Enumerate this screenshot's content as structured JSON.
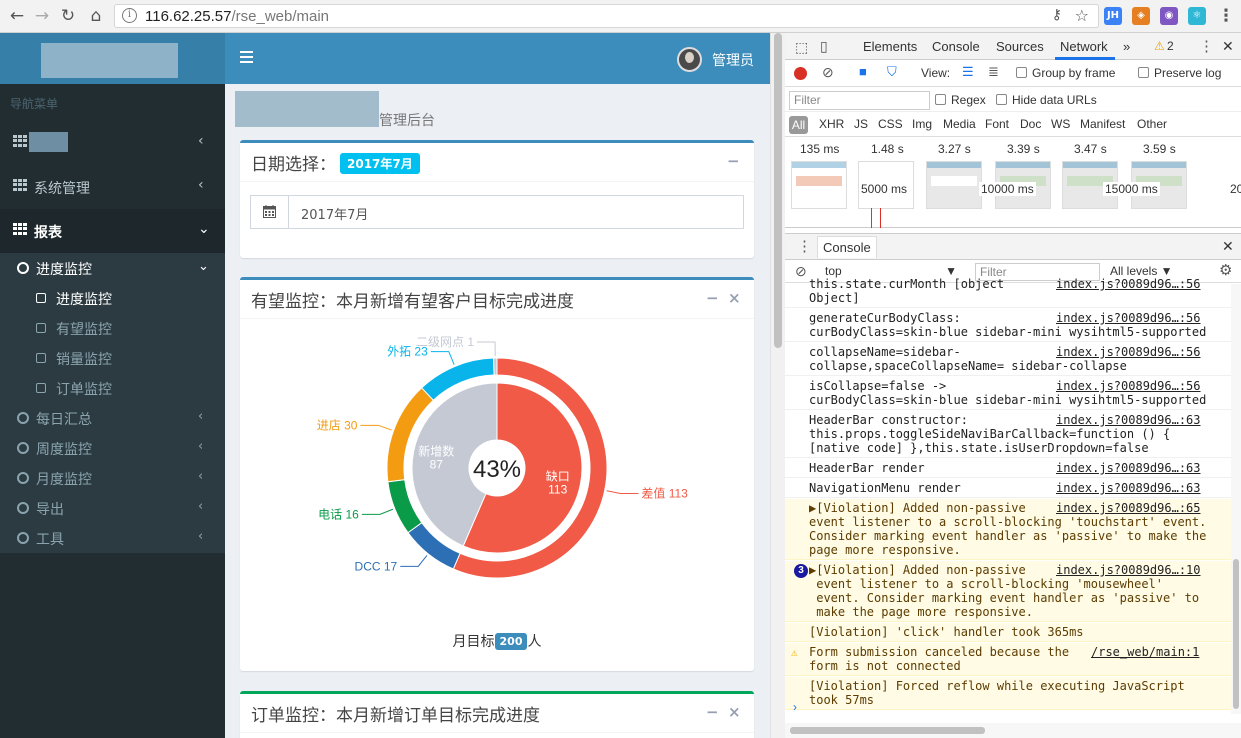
{
  "browser": {
    "url_host": "116.62.25.57",
    "url_path": "/rse_web/main",
    "extensions": [
      {
        "name": "jh-extension-icon",
        "label": "JH",
        "color": "#3b82f6"
      },
      {
        "name": "fox-extension-icon",
        "label": "◈",
        "color": "#e67e22"
      },
      {
        "name": "redux-extension-icon",
        "label": "◉",
        "color": "#7e57c2"
      },
      {
        "name": "react-extension-icon",
        "label": "⚛",
        "color": "#2fb7d6"
      }
    ]
  },
  "app": {
    "topbar": {
      "admin_name": "管理员"
    },
    "sidebar": {
      "header": "导航菜单",
      "items": [
        {
          "label": "",
          "chevron": "‹"
        },
        {
          "label": "系统管理",
          "chevron": "‹"
        },
        {
          "label": "报表",
          "chevron": "⌄"
        }
      ],
      "report_children": [
        {
          "label": "进度监控",
          "chevron": "⌄"
        },
        {
          "label": "每日汇总",
          "chevron": "‹"
        },
        {
          "label": "周度监控",
          "chevron": "‹"
        },
        {
          "label": "月度监控",
          "chevron": "‹"
        },
        {
          "label": "导出",
          "chevron": "‹"
        },
        {
          "label": "工具",
          "chevron": "‹"
        }
      ],
      "progress_children": [
        {
          "label": "进度监控"
        },
        {
          "label": "有望监控"
        },
        {
          "label": "销量监控"
        },
        {
          "label": "订单监控"
        }
      ]
    },
    "content": {
      "title_suffix": "管理后台",
      "date_box": {
        "title": "日期选择：",
        "badge": "2017年7月",
        "collapse": "−",
        "value": "2017年7月"
      },
      "prospect_box": {
        "title": "有望监控：本月新增有望客户目标完成进度",
        "collapse": "−",
        "close": "×",
        "target_prefix": "月目标",
        "target_value": "200",
        "target_suffix": "人"
      },
      "order_box": {
        "title": "订单监控：本月新增订单目标完成进度",
        "collapse": "−",
        "close": "×"
      }
    }
  },
  "chart_data": {
    "type": "pie",
    "center_label": "43%",
    "inner": [
      {
        "name": "缺口",
        "value": 113,
        "color": "#f05a46"
      },
      {
        "name": "新增数",
        "value": 87,
        "color": "#c4c9d4"
      }
    ],
    "outer": [
      {
        "name": "差值",
        "value": 113,
        "color": "#f05a46"
      },
      {
        "name": "DCC",
        "value": 17,
        "color": "#2d6fb5"
      },
      {
        "name": "电话",
        "value": 16,
        "color": "#0a9b48"
      },
      {
        "name": "进店",
        "value": 30,
        "color": "#f39c12"
      },
      {
        "name": "外拓",
        "value": 23,
        "color": "#08b4ea"
      },
      {
        "name": "二级网点",
        "value": 1,
        "color": "#c4c9d4"
      }
    ]
  },
  "devtools": {
    "tabs": [
      "Elements",
      "Console",
      "Sources",
      "Network",
      "»"
    ],
    "warning_count": "2",
    "close": "✕",
    "network": {
      "view_label": "View:",
      "group_by_frame": "Group by frame",
      "preserve_log": "Preserve log",
      "filter_placeholder": "Filter",
      "regex": "Regex",
      "hide_data_urls": "Hide data URLs",
      "types": [
        "All",
        "XHR",
        "JS",
        "CSS",
        "Img",
        "Media",
        "Font",
        "Doc",
        "WS",
        "Manifest",
        "Other"
      ],
      "frame_times": [
        "135 ms",
        "1.48 s",
        "3.27 s",
        "3.39 s",
        "3.47 s",
        "3.59 s"
      ],
      "timeline_marks": [
        "5000 ms",
        "10000 ms",
        "15000 ms",
        "20"
      ]
    },
    "console": {
      "tab": "Console",
      "context": "top",
      "filter_placeholder": "Filter",
      "levels": "All levels ▼",
      "prompt": "›",
      "rows": [
        {
          "text": "this.state.curMonth [object\nObject]",
          "src": "index.js?0089d96…:56"
        },
        {
          "text": "generateCurBodyClass:\ncurBodyClass=skin-blue sidebar-mini wysihtml5-supported",
          "src": "index.js?0089d96…:56"
        },
        {
          "text": "collapseName=sidebar-\ncollapse,spaceCollapseName= sidebar-collapse",
          "src": "index.js?0089d96…:56"
        },
        {
          "text": "isCollapse=false ->\ncurBodyClass=skin-blue sidebar-mini wysihtml5-supported",
          "src": "index.js?0089d96…:56"
        },
        {
          "text": "HeaderBar constructor:\nthis.props.toggleSideNaviBarCallback=function () {\n[native code] },this.state.isUserDropdown=false",
          "src": "index.js?0089d96…:63"
        },
        {
          "text": "HeaderBar render",
          "src": "index.js?0089d96…:63"
        },
        {
          "text": "NavigationMenu render",
          "src": "index.js?0089d96…:63"
        },
        {
          "text": "▶[Violation] Added non-passive\nevent listener to a scroll-blocking 'touchstart' event.\nConsider marking event handler as 'passive' to make the\npage more responsive.",
          "src": "index.js?0089d96…:65",
          "warn": true
        },
        {
          "text": "▶[Violation] Added non-passive\n event listener to a scroll-blocking 'mousewheel'\n event. Consider marking event handler as 'passive' to\n make the page more responsive.",
          "src": "index.js?0089d96…:10",
          "warn": true,
          "count": "3"
        },
        {
          "text": "[Violation] 'click' handler took 365ms",
          "src": "",
          "warn": true
        },
        {
          "text": "Form submission canceled because the\nform is not connected",
          "src": "/rse_web/main:1",
          "warn": true,
          "tri": true
        },
        {
          "text": "[Violation] Forced reflow while executing JavaScript\ntook 57ms",
          "src": "",
          "warn": true
        }
      ]
    }
  }
}
